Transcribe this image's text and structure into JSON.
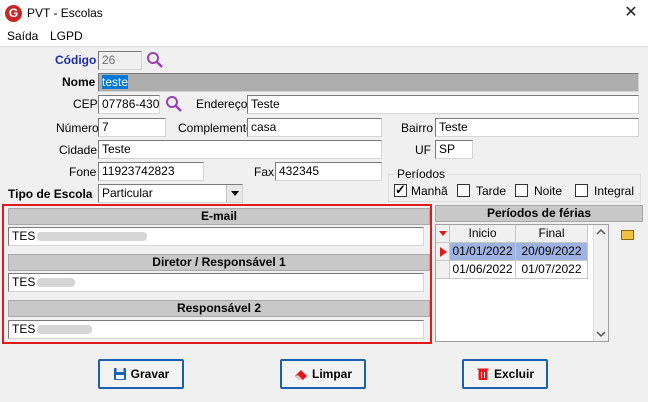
{
  "window": {
    "title": "PVT - Escolas",
    "icon_letter": "G"
  },
  "menu": [
    "Saída",
    "LGPD"
  ],
  "form": {
    "codigo": {
      "label": "Código",
      "value": "26"
    },
    "nome": {
      "label": "Nome",
      "value": "teste"
    },
    "cep": {
      "label": "CEP",
      "value": "07786-430"
    },
    "endereco": {
      "label": "Endereço",
      "value": "Teste"
    },
    "numero": {
      "label": "Número",
      "value": "7"
    },
    "complemento": {
      "label": "Complemento",
      "value": "casa"
    },
    "bairro": {
      "label": "Bairro",
      "value": "Teste"
    },
    "cidade": {
      "label": "Cidade",
      "value": "Teste"
    },
    "uf": {
      "label": "UF",
      "value": "SP"
    },
    "fone": {
      "label": "Fone",
      "value": "11923742823"
    },
    "fax": {
      "label": "Fax",
      "value": "432345"
    },
    "tipo_escola": {
      "label": "Tipo de Escola",
      "value": "Particular"
    }
  },
  "periodos": {
    "title": "Períodos",
    "options": [
      {
        "label": "Manhã",
        "checked": true
      },
      {
        "label": "Tarde",
        "checked": false
      },
      {
        "label": "Noite",
        "checked": false
      },
      {
        "label": "Integral",
        "checked": false
      }
    ]
  },
  "contacts": {
    "email": {
      "title": "E-mail",
      "value": "TES"
    },
    "diretor": {
      "title": "Diretor / Responsável 1",
      "value": "TES"
    },
    "responsavel2": {
      "title": "Responsável 2",
      "value": "TES"
    }
  },
  "ferias": {
    "title": "Períodos de férias",
    "columns": [
      "Inicio",
      "Final"
    ],
    "rows": [
      {
        "inicio": "01/01/2022",
        "final": "20/09/2022",
        "selected": true
      },
      {
        "inicio": "01/06/2022",
        "final": "01/07/2022",
        "selected": false
      }
    ]
  },
  "buttons": {
    "gravar": "Gravar",
    "limpar": "Limpar",
    "excluir": "Excluir"
  },
  "colors": {
    "accent_blue": "#1b5fb0",
    "highlight_red": "#e0191b",
    "selection": "#0078d7"
  }
}
